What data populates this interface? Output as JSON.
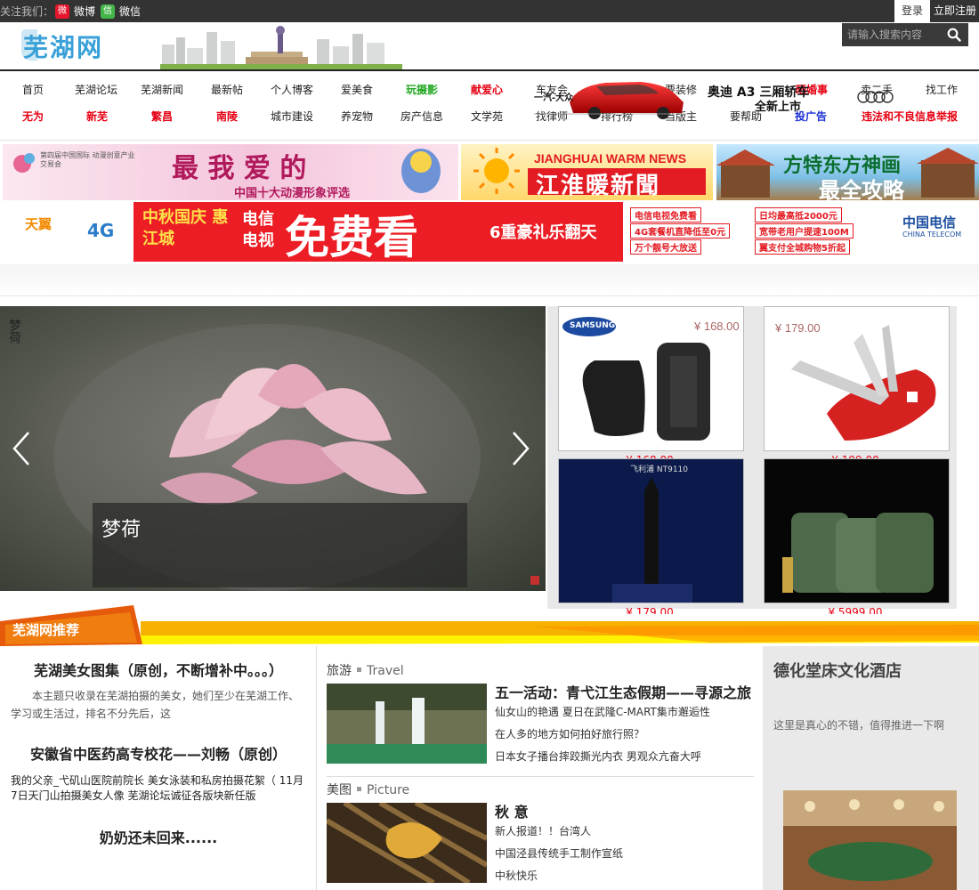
{
  "topbar": {
    "follow_label": "关注我们：",
    "weibo_label": "微博",
    "wechat_label": "微信",
    "login_label": "登录",
    "register_label": "立即注册"
  },
  "header": {
    "logo_text": "芜湖网",
    "search_placeholder": "请输入搜索内容"
  },
  "nav": {
    "row1": [
      {
        "label": "首页",
        "style": "normal"
      },
      {
        "label": "芜湖论坛",
        "style": "normal"
      },
      {
        "label": "芜湖新闻",
        "style": "normal"
      },
      {
        "label": "最新帖",
        "style": "normal"
      },
      {
        "label": "个人博客",
        "style": "normal"
      },
      {
        "label": "爱美食",
        "style": "normal"
      },
      {
        "label": "玩摄影",
        "style": "green"
      },
      {
        "label": "献爱心",
        "style": "red"
      },
      {
        "label": "车友会",
        "style": "normal"
      },
      {
        "label": "要装修",
        "style": "normal"
      },
      {
        "label": "晒婚事",
        "style": "red"
      },
      {
        "label": "卖二手",
        "style": "normal"
      },
      {
        "label": "找工作",
        "style": "normal"
      }
    ],
    "row2": [
      {
        "label": "无为",
        "style": "red"
      },
      {
        "label": "新芜",
        "style": "red"
      },
      {
        "label": "繁昌",
        "style": "red"
      },
      {
        "label": "南陵",
        "style": "red"
      },
      {
        "label": "城市建设",
        "style": "normal"
      },
      {
        "label": "养宠物",
        "style": "normal"
      },
      {
        "label": "房产信息",
        "style": "normal"
      },
      {
        "label": "文学苑",
        "style": "normal"
      },
      {
        "label": "找律师",
        "style": "normal"
      },
      {
        "label": "排行榜",
        "style": "normal"
      },
      {
        "label": "当版主",
        "style": "normal"
      },
      {
        "label": "要帮助",
        "style": "normal"
      },
      {
        "label": "投广告",
        "style": "blue"
      },
      {
        "label": "违法和不良信息举报",
        "style": "red"
      }
    ],
    "car_ad": {
      "brand_line": "一汽-大众",
      "brand": "奥迪",
      "model": "A3 三厢轿车",
      "slogan": "全新上市"
    }
  },
  "banners": {
    "b1": {
      "title_big": "最 我 爱 的",
      "subtitle": "中国十大动漫形象评选",
      "org": "第四届中国国际 动漫创意产业交易会"
    },
    "b2": {
      "en": "JIANGHUAI WARM NEWS",
      "cn": "江淮暖新聞"
    },
    "b3": {
      "cn": "方特东方神画",
      "cn2": "最全攻略"
    },
    "b4": {
      "brand": "天翼",
      "net": "4G",
      "headline": "中秋国庆 惠江城",
      "big": "免费看",
      "sub": "电信 电视",
      "promo": "6重豪礼乐翻天",
      "items": [
        "电信电视免费看",
        "4G套餐机直降低至0元",
        "万个靓号大放送",
        "日均最高抵2000元",
        "宽带老用户提速100M",
        "翼支付全城购物5折起"
      ],
      "company": "中国电信",
      "company_en": "CHINA TELECOM"
    }
  },
  "featured": {
    "caption": "梦荷",
    "vertical_text": "梦荷"
  },
  "products": [
    {
      "price_tag": "¥ 168.00",
      "brand": "SAMSUNG"
    },
    {
      "price_tag": "¥ 179.00"
    },
    {
      "label": "飞利浦 NT9110"
    },
    {}
  ],
  "recommend": {
    "title": "芜湖网推荐"
  },
  "left": {
    "head1": "芜湖美女图集（原创，不断增补中。。。）",
    "desc": "本主题只收录在芜湖拍摄的美女，她们至少在芜湖工作、学习或生活过，排名不分先后，这",
    "head2": "安徽省中医药高专校花——刘畅（原创）",
    "links": [
      "我的父亲_弋矶山医院前院长",
      "美女泳装和私房拍摄花絮（",
      "11月7日天门山拍摄美女人像",
      "芜湖论坛诚征各版块新任版"
    ],
    "head3": "奶奶还未回来......"
  },
  "middle": {
    "travel": {
      "cn": "旅游",
      "en": "Travel",
      "title": "五一活动：青弋江生态假期——寻源之旅",
      "links": [
        "仙女山的艳遇 夏日在武隆C-MART集市邂逅性",
        "在人多的地方如何拍好旅行照？",
        "日本女子播台摔跤撕光内衣 男观众亢奋大呼"
      ]
    },
    "picture": {
      "cn": "美图",
      "en": "Picture",
      "title": "秋 意",
      "links": [
        "新人报道！！台湾人",
        "中国泾县传统手工制作宣纸",
        "中秋快乐"
      ]
    }
  },
  "right": {
    "title": "德化堂床文化酒店",
    "desc": "这里是真心的不错，值得推进一下啊"
  },
  "colors": {
    "accent_red": "#e60012",
    "topbar": "#333333",
    "orange": "#f5a800"
  }
}
